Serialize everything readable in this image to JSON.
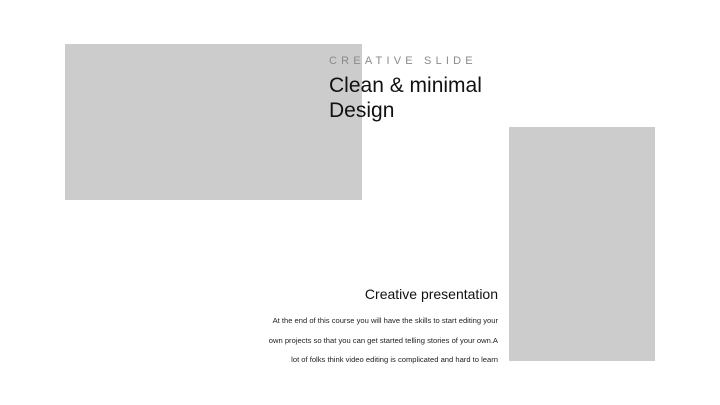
{
  "slide": {
    "kicker": "CREATIVE SLIDE",
    "title_lines": [
      "Clean & minimal",
      "Design"
    ],
    "subheading": "Creative presentation",
    "body_lines": [
      "At the end of this course you will have the skills to start editing your",
      "own projects so that you can get started telling stories of your own.A",
      "lot of folks think video editing is complicated and hard to learn"
    ]
  },
  "colors": {
    "placeholder": "#cccccc",
    "background": "#ffffff",
    "kicker": "#8a8a8a",
    "text": "#111111"
  }
}
